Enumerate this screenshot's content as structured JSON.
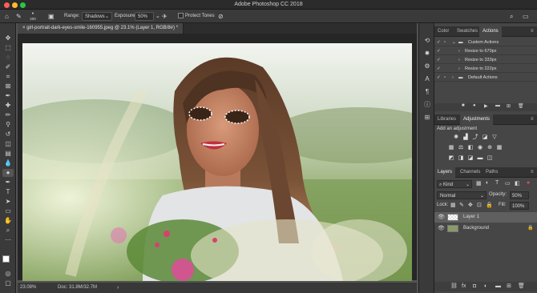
{
  "window": {
    "title": "Adobe Photoshop CC 2018"
  },
  "options": {
    "brush_size": "200",
    "range_label": "Range:",
    "range_value": "Shadows",
    "exposure_label": "Exposure:",
    "exposure_value": "50%",
    "protect_tones": "Protect Tones"
  },
  "document": {
    "tab_title": "girl-portrait-dark-eyes-smile-160955.jpeg @ 23.1% (Layer 1, RGB/8#) *"
  },
  "status": {
    "zoom": "23.08%",
    "doc_info": "Doc: 31.8M/32.7M"
  },
  "actions_panel": {
    "tabs": [
      "Color",
      "Swatches",
      "Actions"
    ],
    "items": [
      "Custom Actions",
      "Resize to 670px",
      "Resize to 333px",
      "Resize to 222px",
      "Default Actions"
    ]
  },
  "adjustments_panel": {
    "tabs": [
      "Libraries",
      "Adjustments"
    ],
    "heading": "Add an adjustment"
  },
  "layers_panel": {
    "tabs": [
      "Layers",
      "Channels",
      "Paths"
    ],
    "kind_label": "Kind",
    "blend_mode": "Normal",
    "opacity_label": "Opacity:",
    "opacity_value": "50%",
    "lock_label": "Lock:",
    "fill_label": "Fill:",
    "fill_value": "100%",
    "layers": [
      "Layer 1",
      "Background"
    ]
  },
  "colors": {
    "accent": "#4a8fd6",
    "panel_bg": "#464646",
    "chrome": "#3a3a3a"
  }
}
